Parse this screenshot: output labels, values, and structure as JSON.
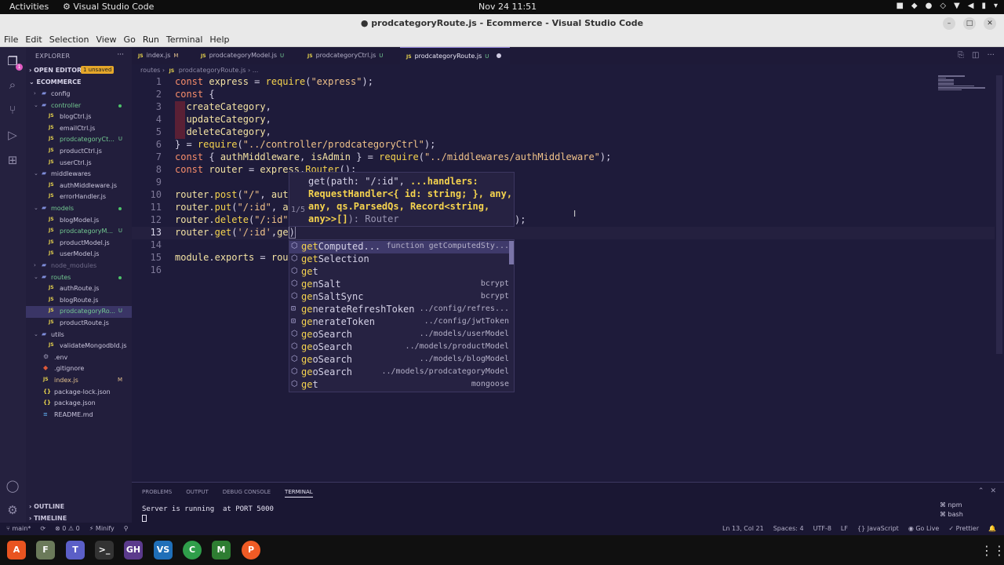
{
  "topbar": {
    "activities": "Activities",
    "app": "Visual Studio Code",
    "clock": "Nov 24  11:51"
  },
  "window": {
    "title": "● prodcategoryRoute.js - Ecommerce - Visual Studio Code"
  },
  "menu": [
    "File",
    "Edit",
    "Selection",
    "View",
    "Go",
    "Run",
    "Terminal",
    "Help"
  ],
  "sidebar": {
    "header": "EXPLORER",
    "open_editors": "OPEN EDITORS",
    "unsaved_badge": "1 unsaved",
    "root": "ECOMMERCE",
    "items": [
      {
        "name": "config",
        "type": "folder",
        "depth": 1,
        "open": false,
        "status": ""
      },
      {
        "name": "controller",
        "type": "folder",
        "depth": 1,
        "open": true,
        "status": "dot"
      },
      {
        "name": "blogCtrl.js",
        "type": "js",
        "depth": 2,
        "status": ""
      },
      {
        "name": "emailCtrl.js",
        "type": "js",
        "depth": 2,
        "status": ""
      },
      {
        "name": "prodcategoryCt...",
        "type": "js",
        "depth": 2,
        "status": "U"
      },
      {
        "name": "productCtrl.js",
        "type": "js",
        "depth": 2,
        "status": ""
      },
      {
        "name": "userCtrl.js",
        "type": "js",
        "depth": 2,
        "status": ""
      },
      {
        "name": "middlewares",
        "type": "folder",
        "depth": 1,
        "open": true,
        "status": ""
      },
      {
        "name": "authMiddleware.js",
        "type": "js",
        "depth": 2,
        "status": ""
      },
      {
        "name": "errorHandler.js",
        "type": "js",
        "depth": 2,
        "status": ""
      },
      {
        "name": "models",
        "type": "folder",
        "depth": 1,
        "open": true,
        "status": "dot"
      },
      {
        "name": "blogModel.js",
        "type": "js",
        "depth": 2,
        "status": ""
      },
      {
        "name": "prodcategoryM...",
        "type": "js",
        "depth": 2,
        "status": "U"
      },
      {
        "name": "productModel.js",
        "type": "js",
        "depth": 2,
        "status": ""
      },
      {
        "name": "userModel.js",
        "type": "js",
        "depth": 2,
        "status": ""
      },
      {
        "name": "node_modules",
        "type": "folder",
        "depth": 1,
        "open": false,
        "status": "",
        "dim": true
      },
      {
        "name": "routes",
        "type": "folder",
        "depth": 1,
        "open": true,
        "status": "dot"
      },
      {
        "name": "authRoute.js",
        "type": "js",
        "depth": 2,
        "status": ""
      },
      {
        "name": "blogRoute.js",
        "type": "js",
        "depth": 2,
        "status": ""
      },
      {
        "name": "prodcategoryRo...",
        "type": "js",
        "depth": 2,
        "status": "U",
        "selected": true
      },
      {
        "name": "productRoute.js",
        "type": "js",
        "depth": 2,
        "status": ""
      },
      {
        "name": "utils",
        "type": "folder",
        "depth": 1,
        "open": true,
        "status": ""
      },
      {
        "name": "validateMongodbId.js",
        "type": "js",
        "depth": 2,
        "status": ""
      },
      {
        "name": ".env",
        "type": "gear",
        "depth": 1,
        "status": ""
      },
      {
        "name": ".gitignore",
        "type": "git",
        "depth": 1,
        "status": ""
      },
      {
        "name": "index.js",
        "type": "js",
        "depth": 1,
        "status": "M"
      },
      {
        "name": "package-lock.json",
        "type": "json",
        "depth": 1,
        "status": ""
      },
      {
        "name": "package.json",
        "type": "json",
        "depth": 1,
        "status": ""
      },
      {
        "name": "README.md",
        "type": "md",
        "depth": 1,
        "status": ""
      }
    ],
    "outline": "OUTLINE",
    "timeline": "TIMELINE"
  },
  "tabs": [
    {
      "label": "index.js",
      "mod": "M",
      "active": false
    },
    {
      "label": "prodcategoryModel.js",
      "mod": "U",
      "active": false
    },
    {
      "label": "prodcategoryCtrl.js",
      "mod": "U",
      "active": false
    },
    {
      "label": "prodcategoryRoute.js",
      "mod": "U",
      "active": true
    }
  ],
  "breadcrumb": {
    "folder": "routes",
    "file": "prodcategoryRoute.js",
    "tail": "..."
  },
  "editor": {
    "current_line": 13,
    "lines": [
      "const express = require(\"express\");",
      "const {",
      "  createCategory,",
      "  updateCategory,",
      "  deleteCategory,",
      "} = require(\"../controller/prodcategoryCtrl\");",
      "const { authMiddleware, isAdmin } = require(\"../middlewares/authMiddleware\");",
      "const router = express.Router();",
      "",
      "router.post(\"/\", aut",
      "router.put(\"/:id\", a",
      "router.delete(\"/:id\"",
      "router.get('/:id',ge)",
      "",
      "module.exports = rou",
      ""
    ],
    "line12_tail": ");"
  },
  "hover": {
    "counter": "1/5",
    "sig1": "get(path: \"/:id\", ",
    "sig1b": "...handlers:",
    "sig2": "RequestHandler<{ id: string; }, any,",
    "sig3": "any, qs.ParsedQs, Record<string,",
    "sig4": "any>>[]",
    "ret": "): Router"
  },
  "suggest": [
    {
      "match": "get",
      "rest": "Computed...",
      "detail": "function getComputedSty...",
      "kind": "method"
    },
    {
      "match": "get",
      "rest": "Selection",
      "detail": "",
      "kind": "method"
    },
    {
      "match": "ge",
      "rest": "t",
      "detail": "",
      "kind": "method"
    },
    {
      "match": "ge",
      "rest": "nSalt",
      "detail": "bcrypt",
      "kind": "method"
    },
    {
      "match": "ge",
      "rest": "nSaltSync",
      "detail": "bcrypt",
      "kind": "method"
    },
    {
      "match": "ge",
      "rest": "nerateRefreshToken",
      "detail": "../config/refres...",
      "kind": "var"
    },
    {
      "match": "ge",
      "rest": "nerateToken",
      "detail": "../config/jwtToken",
      "kind": "var"
    },
    {
      "match": "ge",
      "rest": "oSearch",
      "detail": "../models/userModel",
      "kind": "method"
    },
    {
      "match": "ge",
      "rest": "oSearch",
      "detail": "../models/productModel",
      "kind": "method"
    },
    {
      "match": "ge",
      "rest": "oSearch",
      "detail": "../models/blogModel",
      "kind": "method"
    },
    {
      "match": "ge",
      "rest": "oSearch",
      "detail": "../models/prodcategoryModel",
      "kind": "method"
    },
    {
      "match": "ge",
      "rest": "t",
      "detail": "mongoose",
      "kind": "method"
    }
  ],
  "panel": {
    "tabs": [
      "PROBLEMS",
      "OUTPUT",
      "DEBUG CONSOLE",
      "TERMINAL"
    ],
    "output": "Server is running  at PORT 5000",
    "terminals": [
      "npm",
      "bash"
    ]
  },
  "status": {
    "branch": "main*",
    "errors": "0",
    "warnings": "0",
    "minify": "Minify",
    "position": "Ln 13, Col 21",
    "spaces": "Spaces: 4",
    "encoding": "UTF-8",
    "eol": "LF",
    "language": "JavaScript",
    "golive": "Go Live",
    "prettier": "Prettier"
  },
  "dock": [
    "A",
    "F",
    "T",
    ">_",
    "GH",
    "VS",
    "C",
    "M",
    "P"
  ],
  "colors": {
    "accent": "#8b7fd6",
    "bg": "#1e1b3a",
    "keyword": "#f78d6a",
    "function": "#f5d34e"
  }
}
